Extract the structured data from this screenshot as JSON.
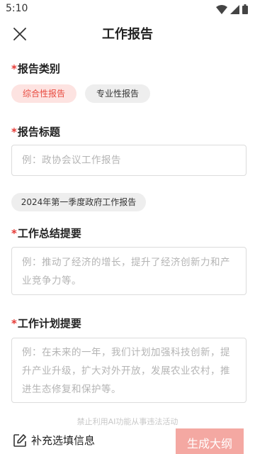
{
  "status_bar": {
    "time": "5:10"
  },
  "header": {
    "title": "工作报告"
  },
  "report_type": {
    "required_mark": "*",
    "label": "报告类别",
    "options": [
      "综合性报告",
      "专业性报告"
    ],
    "selected": "综合性报告"
  },
  "report_title": {
    "required_mark": "*",
    "label": "报告标题",
    "placeholder": "例：政协会议工作报告",
    "value": "",
    "suggestion": "2024年第一季度政府工作报告"
  },
  "work_summary": {
    "required_mark": "*",
    "label": "工作总结提要",
    "placeholder": "例：推动了经济的增长，提升了经济创新力和产业竞争力等。",
    "value": ""
  },
  "work_plan": {
    "required_mark": "*",
    "label": "工作计划提要",
    "placeholder": "例：在未来的一年，我们计划加强科技创新，提升产业升级，扩大对外开放，发展农业农村，推进生态修复和保护等。",
    "value": ""
  },
  "notice": "禁止利用AI功能从事违法活动",
  "footer": {
    "supplement_label": "补充选填信息",
    "generate_label": "生成大纲"
  },
  "colors": {
    "accent": "#e84a3f",
    "accent_light": "#fde3e1",
    "generate_button": "#f4a8a2"
  }
}
